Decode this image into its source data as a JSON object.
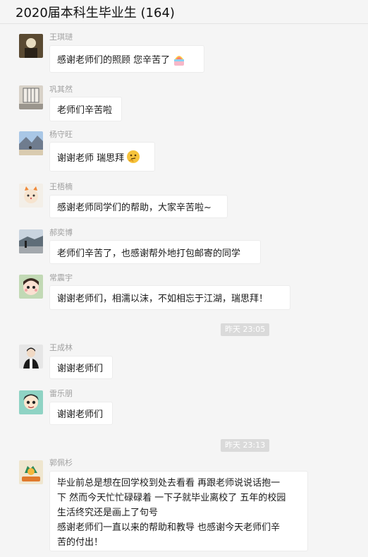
{
  "window": {
    "title": "2020届本科生毕业生 (164)"
  },
  "messages": [
    {
      "sender": "王琪琎",
      "text": "感谢老师们的照顾 您辛苦了",
      "emoji": "rainbow-cake-emoji"
    },
    {
      "sender": "巩其然",
      "text": "老师们辛苦啦"
    },
    {
      "sender": "杨守旺",
      "text": "谢谢老师 瑞思拜",
      "emoji": "thinking-face-emoji"
    },
    {
      "sender": "王梧楠",
      "text": "感谢老师同学们的帮助，大家辛苦啦~"
    },
    {
      "sender": "郝奕博",
      "text": "老师们辛苦了，也感谢帮外地打包邮寄的同学"
    },
    {
      "sender": "常震宇",
      "text": "谢谢老师们，相濡以沫，不如相忘于江湖，瑞思拜！"
    },
    {
      "sender": "王成林",
      "text": "谢谢老师们"
    },
    {
      "sender": "雷乐朋",
      "text": "谢谢老师们"
    },
    {
      "sender": "郭佩杉",
      "lines": [
        "毕业前总是想在回学校到处去看看 再跟老师说说话抱一",
        "下 然而今天忙忙碌碌着 一下子就毕业离校了 五年的校园",
        "生活终究还是画上了句号",
        "感谢老师们一直以来的帮助和教导 也感谢今天老师们辛",
        "苦的付出！"
      ]
    }
  ],
  "timestamps": [
    "昨天 23:05",
    "昨天 23:13"
  ]
}
